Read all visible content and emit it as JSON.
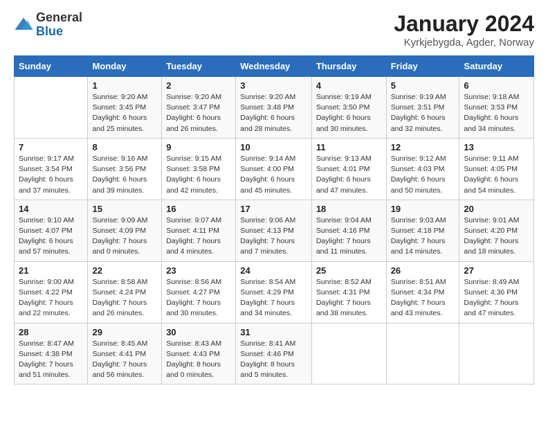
{
  "logo": {
    "general": "General",
    "blue": "Blue"
  },
  "header": {
    "month_year": "January 2024",
    "location": "Kyrkjebygda, Agder, Norway"
  },
  "weekdays": [
    "Sunday",
    "Monday",
    "Tuesday",
    "Wednesday",
    "Thursday",
    "Friday",
    "Saturday"
  ],
  "weeks": [
    [
      {
        "day": "",
        "sunrise": "",
        "sunset": "",
        "daylight": ""
      },
      {
        "day": "1",
        "sunrise": "Sunrise: 9:20 AM",
        "sunset": "Sunset: 3:45 PM",
        "daylight": "Daylight: 6 hours and 25 minutes."
      },
      {
        "day": "2",
        "sunrise": "Sunrise: 9:20 AM",
        "sunset": "Sunset: 3:47 PM",
        "daylight": "Daylight: 6 hours and 26 minutes."
      },
      {
        "day": "3",
        "sunrise": "Sunrise: 9:20 AM",
        "sunset": "Sunset: 3:48 PM",
        "daylight": "Daylight: 6 hours and 28 minutes."
      },
      {
        "day": "4",
        "sunrise": "Sunrise: 9:19 AM",
        "sunset": "Sunset: 3:50 PM",
        "daylight": "Daylight: 6 hours and 30 minutes."
      },
      {
        "day": "5",
        "sunrise": "Sunrise: 9:19 AM",
        "sunset": "Sunset: 3:51 PM",
        "daylight": "Daylight: 6 hours and 32 minutes."
      },
      {
        "day": "6",
        "sunrise": "Sunrise: 9:18 AM",
        "sunset": "Sunset: 3:53 PM",
        "daylight": "Daylight: 6 hours and 34 minutes."
      }
    ],
    [
      {
        "day": "7",
        "sunrise": "Sunrise: 9:17 AM",
        "sunset": "Sunset: 3:54 PM",
        "daylight": "Daylight: 6 hours and 37 minutes."
      },
      {
        "day": "8",
        "sunrise": "Sunrise: 9:16 AM",
        "sunset": "Sunset: 3:56 PM",
        "daylight": "Daylight: 6 hours and 39 minutes."
      },
      {
        "day": "9",
        "sunrise": "Sunrise: 9:15 AM",
        "sunset": "Sunset: 3:58 PM",
        "daylight": "Daylight: 6 hours and 42 minutes."
      },
      {
        "day": "10",
        "sunrise": "Sunrise: 9:14 AM",
        "sunset": "Sunset: 4:00 PM",
        "daylight": "Daylight: 6 hours and 45 minutes."
      },
      {
        "day": "11",
        "sunrise": "Sunrise: 9:13 AM",
        "sunset": "Sunset: 4:01 PM",
        "daylight": "Daylight: 6 hours and 47 minutes."
      },
      {
        "day": "12",
        "sunrise": "Sunrise: 9:12 AM",
        "sunset": "Sunset: 4:03 PM",
        "daylight": "Daylight: 6 hours and 50 minutes."
      },
      {
        "day": "13",
        "sunrise": "Sunrise: 9:11 AM",
        "sunset": "Sunset: 4:05 PM",
        "daylight": "Daylight: 6 hours and 54 minutes."
      }
    ],
    [
      {
        "day": "14",
        "sunrise": "Sunrise: 9:10 AM",
        "sunset": "Sunset: 4:07 PM",
        "daylight": "Daylight: 6 hours and 57 minutes."
      },
      {
        "day": "15",
        "sunrise": "Sunrise: 9:09 AM",
        "sunset": "Sunset: 4:09 PM",
        "daylight": "Daylight: 7 hours and 0 minutes."
      },
      {
        "day": "16",
        "sunrise": "Sunrise: 9:07 AM",
        "sunset": "Sunset: 4:11 PM",
        "daylight": "Daylight: 7 hours and 4 minutes."
      },
      {
        "day": "17",
        "sunrise": "Sunrise: 9:06 AM",
        "sunset": "Sunset: 4:13 PM",
        "daylight": "Daylight: 7 hours and 7 minutes."
      },
      {
        "day": "18",
        "sunrise": "Sunrise: 9:04 AM",
        "sunset": "Sunset: 4:16 PM",
        "daylight": "Daylight: 7 hours and 11 minutes."
      },
      {
        "day": "19",
        "sunrise": "Sunrise: 9:03 AM",
        "sunset": "Sunset: 4:18 PM",
        "daylight": "Daylight: 7 hours and 14 minutes."
      },
      {
        "day": "20",
        "sunrise": "Sunrise: 9:01 AM",
        "sunset": "Sunset: 4:20 PM",
        "daylight": "Daylight: 7 hours and 18 minutes."
      }
    ],
    [
      {
        "day": "21",
        "sunrise": "Sunrise: 9:00 AM",
        "sunset": "Sunset: 4:22 PM",
        "daylight": "Daylight: 7 hours and 22 minutes."
      },
      {
        "day": "22",
        "sunrise": "Sunrise: 8:58 AM",
        "sunset": "Sunset: 4:24 PM",
        "daylight": "Daylight: 7 hours and 26 minutes."
      },
      {
        "day": "23",
        "sunrise": "Sunrise: 8:56 AM",
        "sunset": "Sunset: 4:27 PM",
        "daylight": "Daylight: 7 hours and 30 minutes."
      },
      {
        "day": "24",
        "sunrise": "Sunrise: 8:54 AM",
        "sunset": "Sunset: 4:29 PM",
        "daylight": "Daylight: 7 hours and 34 minutes."
      },
      {
        "day": "25",
        "sunrise": "Sunrise: 8:52 AM",
        "sunset": "Sunset: 4:31 PM",
        "daylight": "Daylight: 7 hours and 38 minutes."
      },
      {
        "day": "26",
        "sunrise": "Sunrise: 8:51 AM",
        "sunset": "Sunset: 4:34 PM",
        "daylight": "Daylight: 7 hours and 43 minutes."
      },
      {
        "day": "27",
        "sunrise": "Sunrise: 8:49 AM",
        "sunset": "Sunset: 4:36 PM",
        "daylight": "Daylight: 7 hours and 47 minutes."
      }
    ],
    [
      {
        "day": "28",
        "sunrise": "Sunrise: 8:47 AM",
        "sunset": "Sunset: 4:38 PM",
        "daylight": "Daylight: 7 hours and 51 minutes."
      },
      {
        "day": "29",
        "sunrise": "Sunrise: 8:45 AM",
        "sunset": "Sunset: 4:41 PM",
        "daylight": "Daylight: 7 hours and 56 minutes."
      },
      {
        "day": "30",
        "sunrise": "Sunrise: 8:43 AM",
        "sunset": "Sunset: 4:43 PM",
        "daylight": "Daylight: 8 hours and 0 minutes."
      },
      {
        "day": "31",
        "sunrise": "Sunrise: 8:41 AM",
        "sunset": "Sunset: 4:46 PM",
        "daylight": "Daylight: 8 hours and 5 minutes."
      },
      {
        "day": "",
        "sunrise": "",
        "sunset": "",
        "daylight": ""
      },
      {
        "day": "",
        "sunrise": "",
        "sunset": "",
        "daylight": ""
      },
      {
        "day": "",
        "sunrise": "",
        "sunset": "",
        "daylight": ""
      }
    ]
  ]
}
